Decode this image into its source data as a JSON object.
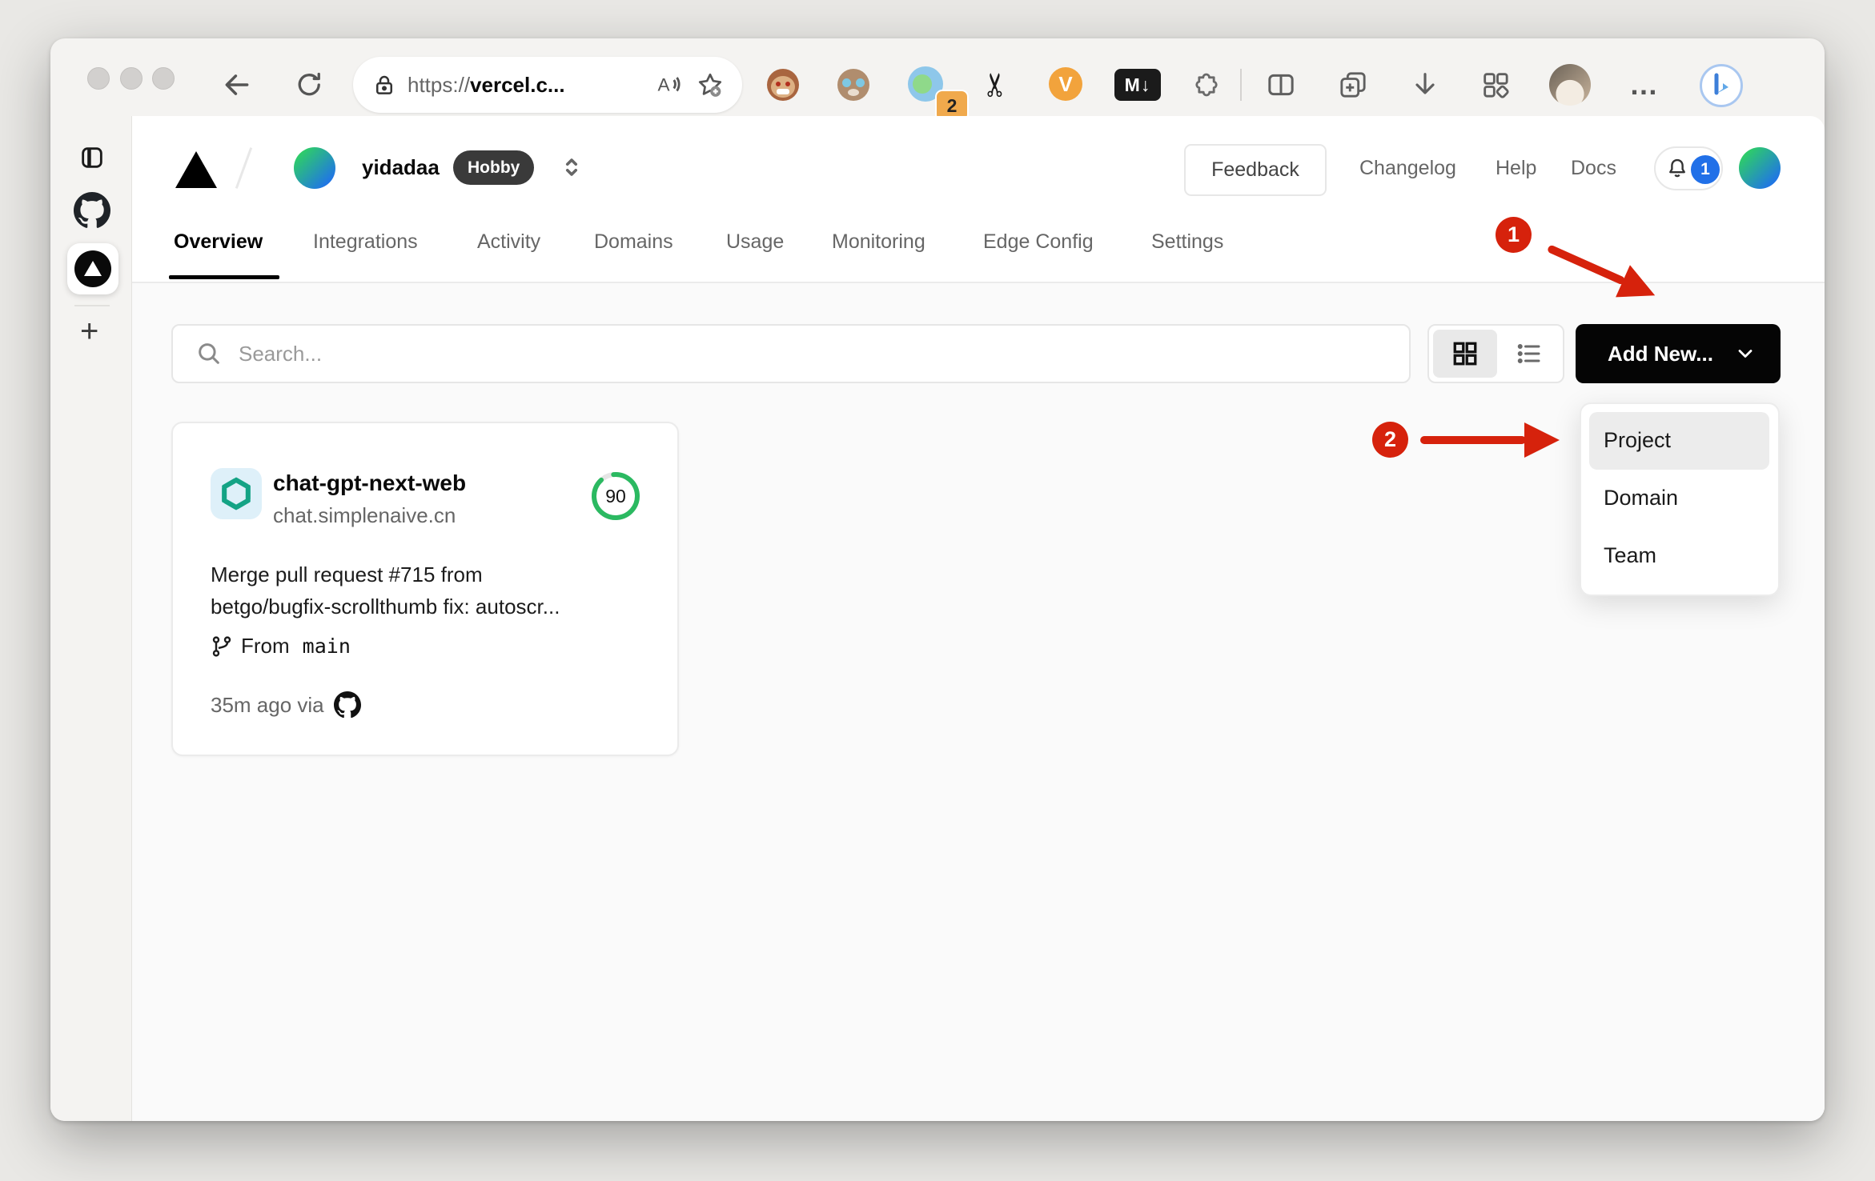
{
  "browser": {
    "url_prefix": "https://",
    "url_host": "vercel.c...",
    "extension_badge_count": "2",
    "markdownload_label": "M↓",
    "video_ext_label": "V",
    "scissors_glyph": "✂",
    "more_label": "…",
    "new_tab_label": "+"
  },
  "header": {
    "team_name": "yidadaa",
    "plan_badge": "Hobby",
    "feedback_label": "Feedback",
    "links": [
      "Changelog",
      "Help",
      "Docs"
    ],
    "notification_count": "1"
  },
  "tabs": [
    "Overview",
    "Integrations",
    "Activity",
    "Domains",
    "Usage",
    "Monitoring",
    "Edge Config",
    "Settings"
  ],
  "toolbar": {
    "search_placeholder": "Search...",
    "add_new_label": "Add New..."
  },
  "project_card": {
    "name": "chat-gpt-next-web",
    "domain": "chat.simplenaive.cn",
    "score": "90",
    "commit_line1": "Merge pull request #715 from",
    "commit_line2": "betgo/bugfix-scrollthumb fix: autoscr...",
    "branch_prefix": "From",
    "branch_name": "main",
    "deployed_ago": "35m ago via"
  },
  "dropdown": {
    "items": [
      "Project",
      "Domain",
      "Team"
    ]
  },
  "annotations": {
    "step1": "1",
    "step2": "2"
  },
  "colors": {
    "annotation_red": "#d6220c",
    "score_green": "#2bb961",
    "notification_blue": "#2170e8",
    "add_new_black": "#050505",
    "page_gray": "#fafafa",
    "openai_teal": "#14a385"
  }
}
